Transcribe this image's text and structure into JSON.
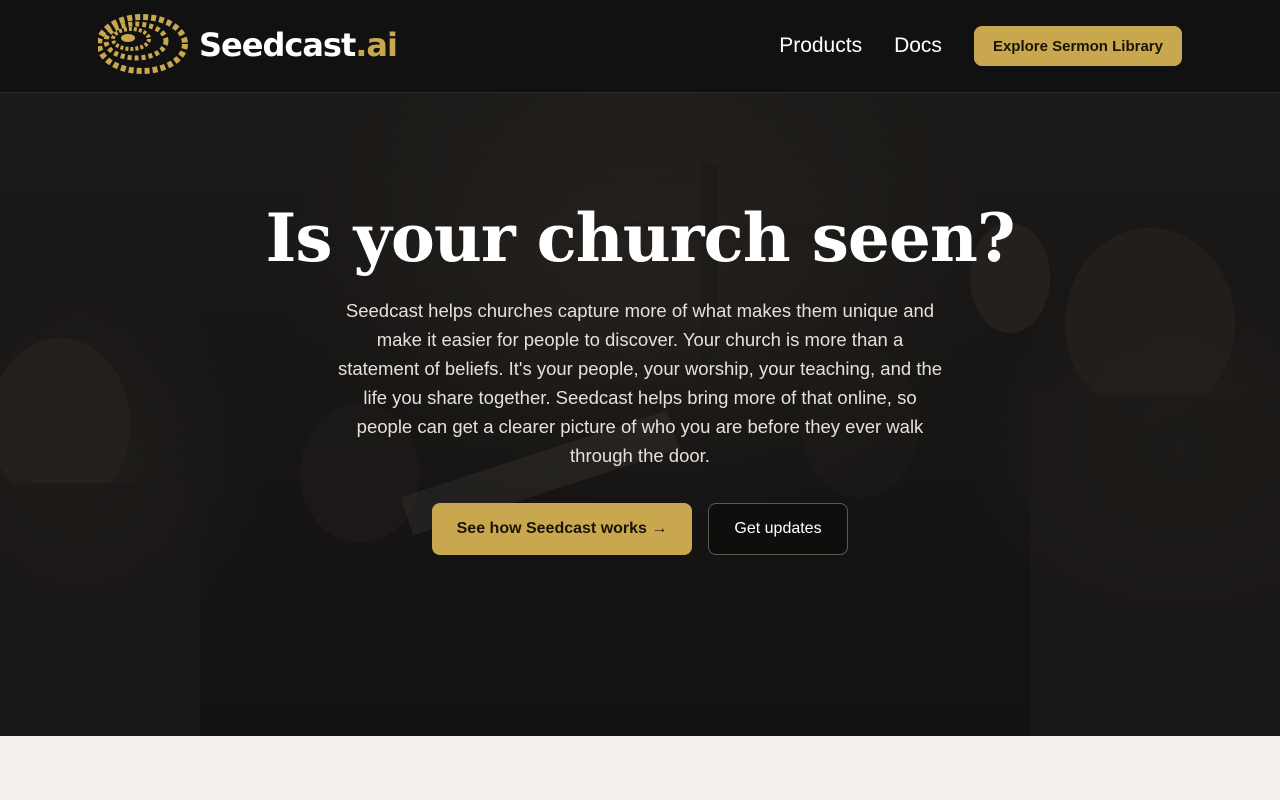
{
  "header": {
    "logo_icon": "seed-spiral-logo-icon",
    "brand_main": "Seedcast",
    "brand_accent": ".ai",
    "nav": [
      {
        "label": "Products"
      },
      {
        "label": "Docs"
      }
    ],
    "cta_label": "Explore Sermon Library"
  },
  "hero": {
    "title": "Is your church seen?",
    "text": "Seedcast helps churches capture more of what makes them unique and make it easier for people to discover. Your church is more than a statement of beliefs. It's your people, your worship, your teaching, and the life you share together. Seedcast helps bring more of that online, so people can get a clearer picture of who you are before they ever walk through the door.",
    "primary_cta": "See how Seedcast works →",
    "secondary_cta": "Get updates"
  },
  "colors": {
    "accent": "#c9a74e",
    "header_bg": "#111111",
    "page_bg": "#f4efea"
  }
}
